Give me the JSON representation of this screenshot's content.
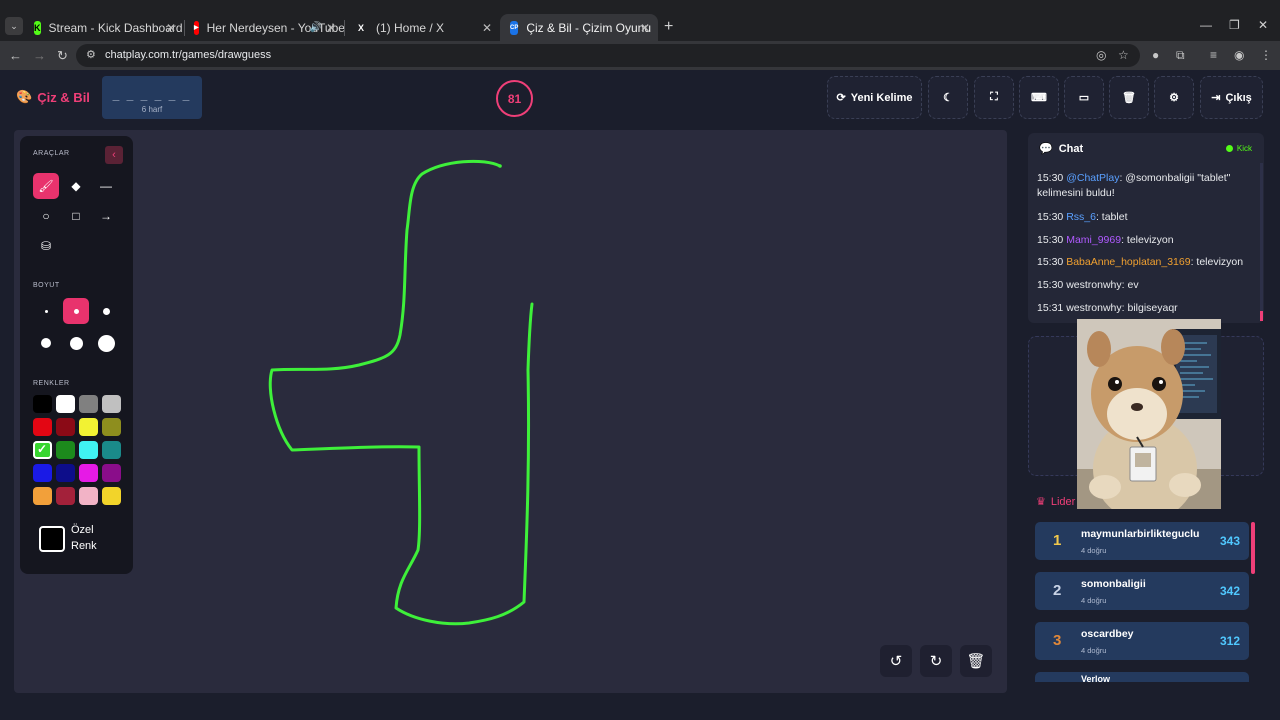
{
  "browser": {
    "tabs": [
      {
        "title": "Stream - Kick Dashboard",
        "favicon": "kick-icon"
      },
      {
        "title": "Her Nerdeysen - YouTube",
        "favicon": "youtube-icon"
      },
      {
        "title": "(1) Home / X",
        "favicon": "x-icon"
      },
      {
        "title": "Çiz & Bil - Çizim Oyunu",
        "favicon": "cp-icon",
        "favicon_text": "CP",
        "active": true
      }
    ],
    "url": "chatplay.com.tr/games/drawguess"
  },
  "header": {
    "logo": "Çiz & Bil",
    "word_blanks": "_ _ _ _ _ _",
    "word_length_label": "6 harf",
    "timer": "81",
    "new_word_label": "Yeni Kelime",
    "exit_label": "Çıkış"
  },
  "tools": {
    "tools_title": "ARAÇLAR",
    "size_title": "BOYUT",
    "colors_title": "RENKLER",
    "custom_color_label_1": "Özel",
    "custom_color_label_2": "Renk",
    "colors": [
      "#000000",
      "#ffffff",
      "#808080",
      "#c0c0c0",
      "#e30613",
      "#8b0a16",
      "#f2f233",
      "#8e8e1e",
      "#37d62f",
      "#1c8a1c",
      "#40f2f2",
      "#1a8a8a",
      "#1a1ae6",
      "#0d0d8a",
      "#e61ae6",
      "#8a0d8a",
      "#f2a03a",
      "#a3213a",
      "#f2b3c6",
      "#f2d42a"
    ],
    "selected_color": "#37d62f"
  },
  "chat": {
    "title": "Chat",
    "platform": "Kick",
    "messages": [
      {
        "time": "15:30",
        "user": "@ChatPlay",
        "user_color": "#5aa0ff",
        "text": ": @somonbaligii \"tablet\" kelimesini buldu!"
      },
      {
        "time": "15:30",
        "user": "Rss_6",
        "user_color": "#5aa0ff",
        "text": ": tablet"
      },
      {
        "time": "15:30",
        "user": "Mami_9969",
        "user_color": "#b05aff",
        "text": ": televizyon"
      },
      {
        "time": "15:30",
        "user": "BabaAnne_hoplatan_3169",
        "user_color": "#f0a030",
        "text": ": televizyon"
      },
      {
        "time": "15:30",
        "user": "westronwhy",
        "user_color": "#e8eaed",
        "text": ": ev"
      },
      {
        "time": "15:31",
        "user": "westronwhy",
        "user_color": "#e8eaed",
        "text": ": bilgiseyaqr"
      }
    ]
  },
  "leaderboard": {
    "title": "Lider",
    "rows": [
      {
        "rank": "1",
        "name": "maymunlarbirlikteguclu",
        "sub": "4 doğru",
        "score": "343",
        "rank_color": "#f2c94c"
      },
      {
        "rank": "2",
        "name": "somonbaligii",
        "sub": "4 doğru",
        "score": "342",
        "rank_color": "#c9d3e6"
      },
      {
        "rank": "3",
        "name": "oscardbey",
        "sub": "4 doğru",
        "score": "312",
        "rank_color": "#e0883a"
      }
    ],
    "next_partial": "Verlow"
  }
}
